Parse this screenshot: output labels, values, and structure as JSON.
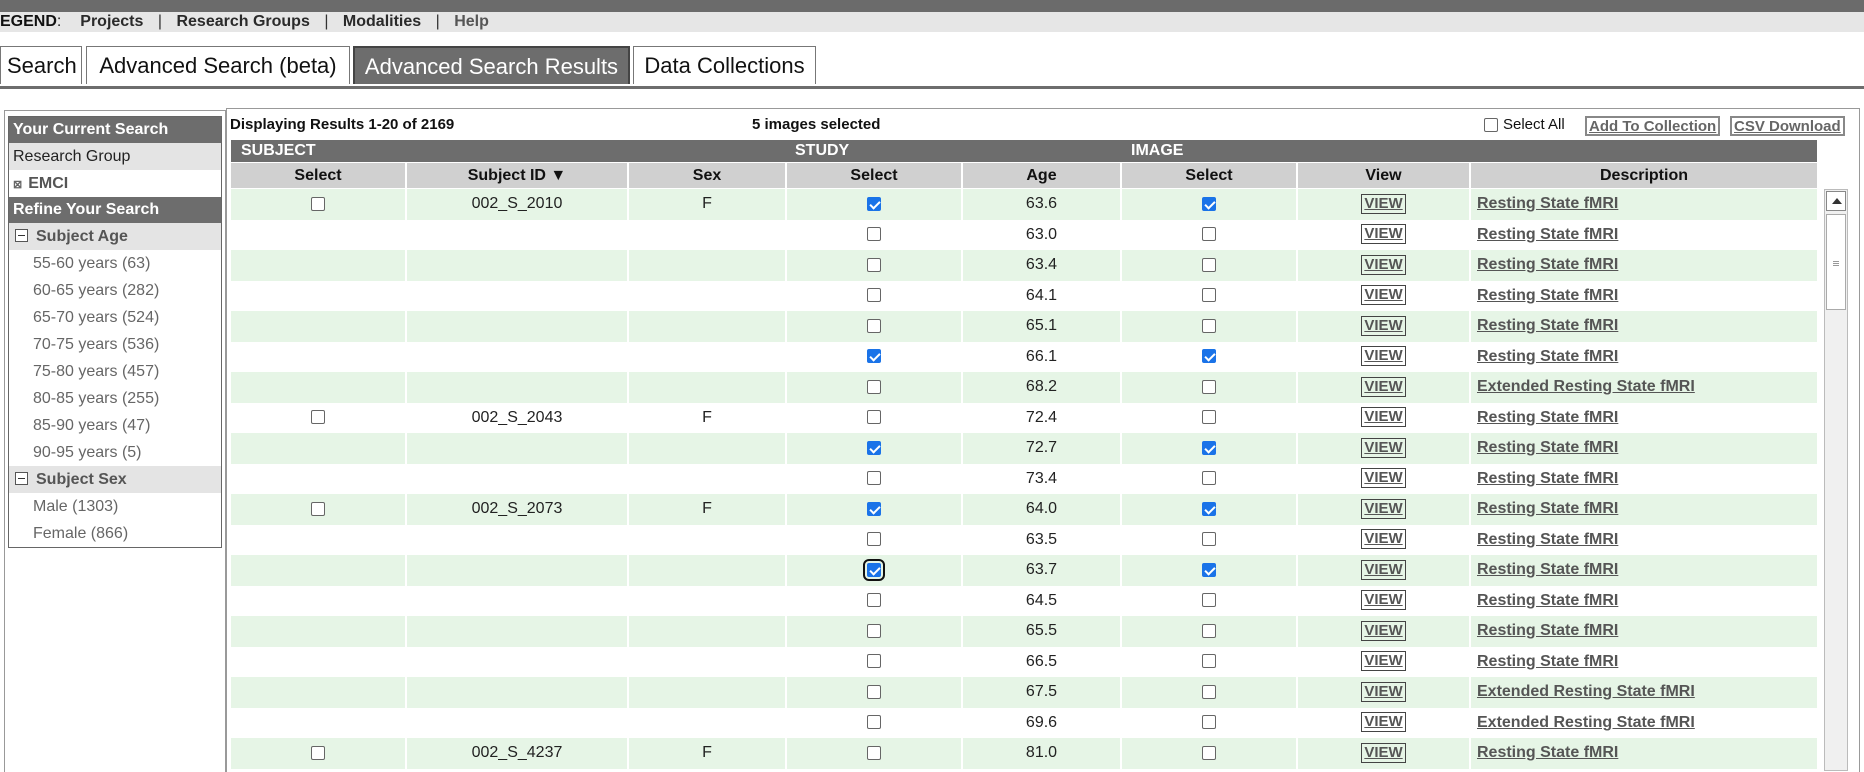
{
  "legend": {
    "label": "EGEND",
    "colon": ":",
    "separator": "|",
    "links": [
      "Projects",
      "Research Groups",
      "Modalities",
      "Help"
    ]
  },
  "tabs": [
    {
      "label": "Search",
      "active": false
    },
    {
      "label": "Advanced Search (beta)",
      "active": false
    },
    {
      "label": "Advanced Search Results",
      "active": true
    },
    {
      "label": "Data Collections",
      "active": false
    }
  ],
  "sidebar": {
    "current_search_title": "Your Current Search",
    "research_group_label": "Research Group",
    "research_group_value": "EMCI",
    "refine_title": "Refine Your Search",
    "facets": [
      {
        "title": "Subject Age",
        "items": [
          "55-60 years (63)",
          "60-65 years (282)",
          "65-70 years (524)",
          "70-75 years (536)",
          "75-80 years (457)",
          "80-85 years (255)",
          "85-90 years (47)",
          "90-95 years (5)"
        ]
      },
      {
        "title": "Subject Sex",
        "items": [
          "Male (1303)",
          "Female (866)"
        ]
      }
    ]
  },
  "results": {
    "displaying": "Displaying Results 1-20 of 2169",
    "selected_count": "5 images selected",
    "select_all_label": "Select All",
    "add_to_collection": "Add To Collection",
    "csv_download": "CSV Download",
    "groups": {
      "subject": "SUBJECT",
      "study": "STUDY",
      "image": "IMAGE"
    },
    "columns": {
      "subject_select": "Select",
      "subject_id": "Subject ID ▼",
      "sex": "Sex",
      "study_select": "Select",
      "age": "Age",
      "image_select": "Select",
      "view": "View",
      "description": "Description"
    },
    "view_label": "VIEW",
    "rows": [
      {
        "subject_id": "002_S_2010",
        "sex": "F",
        "subject_cb": true,
        "study_checked": true,
        "age": "63.6",
        "image_checked": true,
        "description": "Resting State fMRI"
      },
      {
        "subject_id": "",
        "sex": "",
        "subject_cb": false,
        "study_checked": false,
        "age": "63.0",
        "image_checked": false,
        "description": "Resting State fMRI"
      },
      {
        "subject_id": "",
        "sex": "",
        "subject_cb": false,
        "study_checked": false,
        "age": "63.4",
        "image_checked": false,
        "description": "Resting State fMRI"
      },
      {
        "subject_id": "",
        "sex": "",
        "subject_cb": false,
        "study_checked": false,
        "age": "64.1",
        "image_checked": false,
        "description": "Resting State fMRI"
      },
      {
        "subject_id": "",
        "sex": "",
        "subject_cb": false,
        "study_checked": false,
        "age": "65.1",
        "image_checked": false,
        "description": "Resting State fMRI"
      },
      {
        "subject_id": "",
        "sex": "",
        "subject_cb": false,
        "study_checked": true,
        "age": "66.1",
        "image_checked": true,
        "description": "Resting State fMRI"
      },
      {
        "subject_id": "",
        "sex": "",
        "subject_cb": false,
        "study_checked": false,
        "age": "68.2",
        "image_checked": false,
        "description": "Extended Resting State fMRI"
      },
      {
        "subject_id": "002_S_2043",
        "sex": "F",
        "subject_cb": true,
        "study_checked": false,
        "age": "72.4",
        "image_checked": false,
        "description": "Resting State fMRI"
      },
      {
        "subject_id": "",
        "sex": "",
        "subject_cb": false,
        "study_checked": true,
        "age": "72.7",
        "image_checked": true,
        "description": "Resting State fMRI"
      },
      {
        "subject_id": "",
        "sex": "",
        "subject_cb": false,
        "study_checked": false,
        "age": "73.4",
        "image_checked": false,
        "description": "Resting State fMRI"
      },
      {
        "subject_id": "002_S_2073",
        "sex": "F",
        "subject_cb": true,
        "study_checked": true,
        "age": "64.0",
        "image_checked": true,
        "description": "Resting State fMRI"
      },
      {
        "subject_id": "",
        "sex": "",
        "subject_cb": false,
        "study_checked": false,
        "age": "63.5",
        "image_checked": false,
        "description": "Resting State fMRI"
      },
      {
        "subject_id": "",
        "sex": "",
        "subject_cb": false,
        "study_checked": true,
        "study_focus": true,
        "age": "63.7",
        "image_checked": true,
        "description": "Resting State fMRI"
      },
      {
        "subject_id": "",
        "sex": "",
        "subject_cb": false,
        "study_checked": false,
        "age": "64.5",
        "image_checked": false,
        "description": "Resting State fMRI"
      },
      {
        "subject_id": "",
        "sex": "",
        "subject_cb": false,
        "study_checked": false,
        "age": "65.5",
        "image_checked": false,
        "description": "Resting State fMRI"
      },
      {
        "subject_id": "",
        "sex": "",
        "subject_cb": false,
        "study_checked": false,
        "age": "66.5",
        "image_checked": false,
        "description": "Resting State fMRI"
      },
      {
        "subject_id": "",
        "sex": "",
        "subject_cb": false,
        "study_checked": false,
        "age": "67.5",
        "image_checked": false,
        "description": "Extended Resting State fMRI"
      },
      {
        "subject_id": "",
        "sex": "",
        "subject_cb": false,
        "study_checked": false,
        "age": "69.6",
        "image_checked": false,
        "description": "Extended Resting State fMRI"
      },
      {
        "subject_id": "002_S_4237",
        "sex": "F",
        "subject_cb": true,
        "study_checked": false,
        "age": "81.0",
        "image_checked": false,
        "description": "Resting State fMRI"
      }
    ]
  },
  "colors": {
    "header_grey": "#6d6d6d",
    "row_green": "#e6f5e6",
    "checkbox_blue": "#1a73e8"
  },
  "icons": {
    "sort_desc": "sort-descending-icon",
    "collapse": "minus-box-icon",
    "remove_filter": "x-box-icon",
    "scroll_up": "arrow-up-icon"
  }
}
